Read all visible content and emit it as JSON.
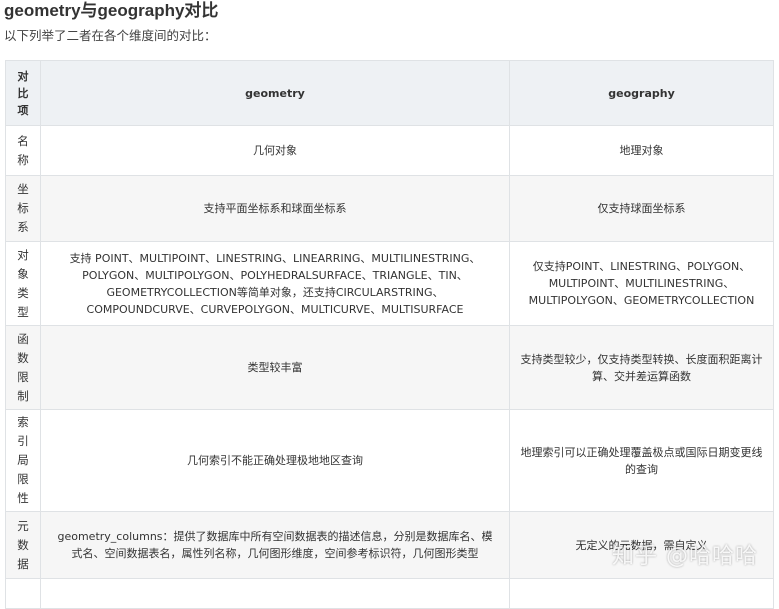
{
  "title": "geometry与geography对比",
  "intro": "以下列举了二者在各个维度间的对比：",
  "headers": [
    "对比项",
    "geometry",
    "geography"
  ],
  "rows": [
    {
      "item": "名称",
      "geometry": "几何对象",
      "geography": "地理对象"
    },
    {
      "item": "坐标系",
      "geometry": "支持平面坐标系和球面坐标系",
      "geography": "仅支持球面坐标系"
    },
    {
      "item": "对象类型",
      "geometry": "支持 POINT、MULTIPOINT、LINESTRING、LINEARRING、MULTILINESTRING、POLYGON、MULTIPOLYGON、POLYHEDRALSURFACE、TRIANGLE、TIN、GEOMETRYCOLLECTION等简单对象，还支持CIRCULARSTRING、COMPOUNDCURVE、CURVEPOLYGON、MULTICURVE、MULTISURFACE",
      "geography": "仅支持POINT、LINESTRING、POLYGON、MULTIPOINT、MULTILINESTRING、MULTIPOLYGON、GEOMETRYCOLLECTION"
    },
    {
      "item": "函数限制",
      "geometry": "类型较丰富",
      "geography": "支持类型较少，仅支持类型转换、长度面积距离计算、交并差运算函数"
    },
    {
      "item": "索引局限性",
      "geometry": "几何索引不能正确处理极地地区查询",
      "geography": "地理索引可以正确处理覆盖极点或国际日期变更线的查询"
    },
    {
      "item": "元数据",
      "geometry": "geometry_columns：提供了数据库中所有空间数据表的描述信息，分别是数据库名、模式名、空间数据表名，属性列名称，几何图形维度，空间参考标识符，几何图形类型",
      "geography": "无定义的元数据，需自定义"
    }
  ],
  "watermark": "知乎 @哈哈哈"
}
